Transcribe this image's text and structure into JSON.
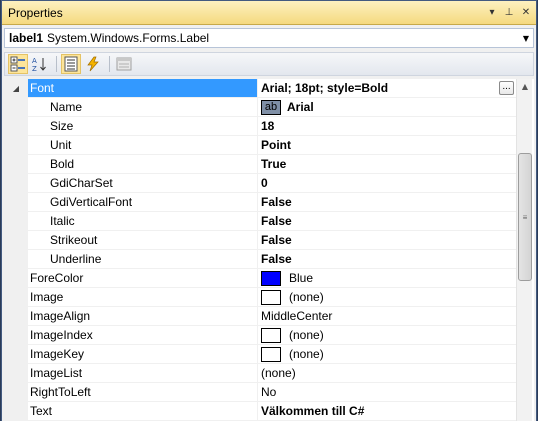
{
  "window": {
    "title": "Properties",
    "controls": {
      "dropdown_glyph": "▾",
      "pin_glyph": "⊥",
      "close_glyph": "✕"
    }
  },
  "object_selector": {
    "name": "label1",
    "type": "System.Windows.Forms.Label",
    "arrow": "▼"
  },
  "toolbar": {
    "buttons": [
      {
        "name": "categorized-icon",
        "active": true
      },
      {
        "name": "alphabetical-icon",
        "active": false
      },
      {
        "name": "properties-icon",
        "active": true
      },
      {
        "name": "events-icon",
        "active": false
      },
      {
        "name": "property-pages-icon",
        "active": false
      }
    ]
  },
  "grid": {
    "rows": [
      {
        "name": "Font",
        "value": "Arial; 18pt; style=Bold",
        "expander": "◢",
        "selected": true,
        "ellipsis": "..."
      },
      {
        "name": "Name",
        "value": "Arial",
        "sub": true,
        "font_preview": "ab"
      },
      {
        "name": "Size",
        "value": "18",
        "sub": true
      },
      {
        "name": "Unit",
        "value": "Point",
        "sub": true
      },
      {
        "name": "Bold",
        "value": "True",
        "sub": true
      },
      {
        "name": "GdiCharSet",
        "value": "0",
        "sub": true
      },
      {
        "name": "GdiVerticalFont",
        "value": "False",
        "sub": true
      },
      {
        "name": "Italic",
        "value": "False",
        "sub": true
      },
      {
        "name": "Strikeout",
        "value": "False",
        "sub": true
      },
      {
        "name": "Underline",
        "value": "False",
        "sub": true
      },
      {
        "name": "ForeColor",
        "value": "Blue",
        "swatch": "#0000ff"
      },
      {
        "name": "Image",
        "value": "(none)",
        "swatch": "#ffffff"
      },
      {
        "name": "ImageAlign",
        "value": "MiddleCenter"
      },
      {
        "name": "ImageIndex",
        "value": "(none)",
        "swatch": "#ffffff"
      },
      {
        "name": "ImageKey",
        "value": "(none)",
        "swatch": "#ffffff"
      },
      {
        "name": "ImageList",
        "value": "(none)"
      },
      {
        "name": "RightToLeft",
        "value": "No"
      },
      {
        "name": "Text",
        "value": "Välkommen till C#",
        "bold": true
      }
    ]
  },
  "scrollbar": {
    "up": "▲",
    "grip": "≡"
  },
  "colors": {
    "selection": "#3399ff",
    "titlebar": "#f5d97f"
  }
}
